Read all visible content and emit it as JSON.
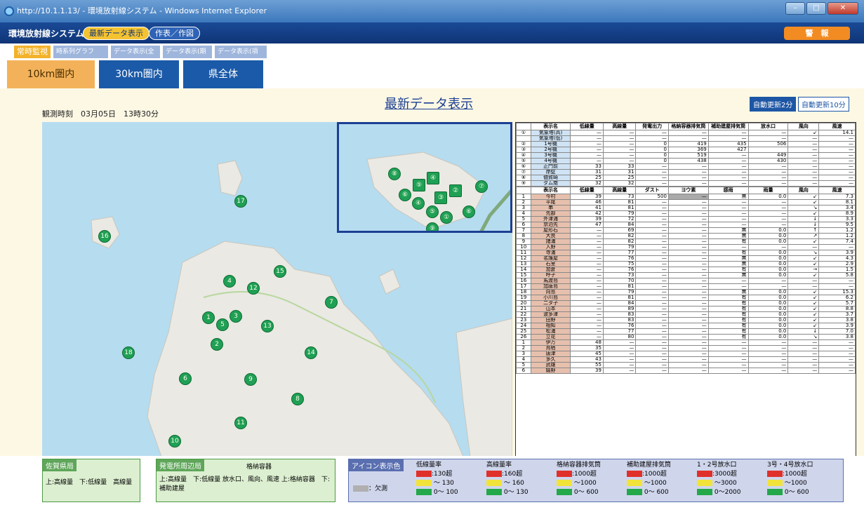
{
  "window": {
    "title": "http://10.1.1.13/ - 環境放射線システム - Windows Internet Explorer"
  },
  "app": {
    "name": "環境放射線システム",
    "btn_latest": "最新データ表示",
    "btn_chart": "作表／作図",
    "alarm": "警　報"
  },
  "subtabs": [
    "常時監視",
    "時系列グラフ",
    "データ表示(全局)",
    "データ表示(期間)",
    "データ表示(項目別)"
  ],
  "areatabs": [
    "10km圏内",
    "30km圏内",
    "県全体"
  ],
  "main": {
    "title": "最新データ表示",
    "obs_time": "観測時刻　03月05日　13時30分",
    "auto2": "自動更新2分",
    "auto10": "自動更新10分"
  },
  "map": {
    "markers": [
      "1",
      "2",
      "3",
      "4",
      "5",
      "6",
      "7",
      "8",
      "9",
      "10",
      "11",
      "12",
      "13",
      "14",
      "15",
      "16",
      "17",
      "18"
    ],
    "inset_markers": [
      "①",
      "②",
      "③",
      "④",
      "⑤",
      "⑥",
      "⑦",
      "⑧",
      "⑨",
      "⑩"
    ]
  },
  "table1": {
    "headers": [
      "",
      "表示名",
      "低線量",
      "高線量",
      "発電出力",
      "格納容器排気筒",
      "補助建屋排気筒",
      "放水口",
      "風向",
      "風速"
    ],
    "rows": [
      [
        "①",
        "気象塔(高)",
        "—",
        "—",
        "—",
        "—",
        "—",
        "—",
        "↙",
        "14.1"
      ],
      [
        "",
        "気象塔(低)",
        "—",
        "—",
        "—",
        "—",
        "—",
        "—",
        "—",
        "—"
      ],
      [
        "②",
        "1号機",
        "—",
        "—",
        "0",
        "419",
        "435",
        "506",
        "—",
        "—"
      ],
      [
        "③",
        "2号機",
        "—",
        "—",
        "0",
        "369",
        "427",
        "",
        "—",
        "—"
      ],
      [
        "④",
        "3号機",
        "—",
        "—",
        "0",
        "519",
        "—",
        "449",
        "—",
        "—"
      ],
      [
        "⑤",
        "4号機",
        "—",
        "—",
        "0",
        "438",
        "—",
        "430",
        "—",
        "—"
      ],
      [
        "⑥",
        "正門前",
        "33",
        "33",
        "—",
        "—",
        "—",
        "—",
        "—",
        "—"
      ],
      [
        "⑦",
        "岸壁",
        "31",
        "31",
        "—",
        "—",
        "—",
        "—",
        "—",
        "—"
      ],
      [
        "⑧",
        "値賀崎",
        "25",
        "25",
        "—",
        "—",
        "—",
        "—",
        "—",
        "—"
      ],
      [
        "⑨",
        "ダム南",
        "32",
        "32",
        "—",
        "—",
        "—",
        "—",
        "—",
        "—"
      ]
    ]
  },
  "table2": {
    "headers": [
      "",
      "表示名",
      "低線量",
      "高線量",
      "ダスト",
      "ヨウ素",
      "感雨",
      "雨量",
      "風向",
      "風速"
    ],
    "rows": [
      [
        "1",
        "今村",
        "39",
        "73",
        "500",
        "—",
        "無",
        "0.0",
        "↙",
        "7.3"
      ],
      [
        "2",
        "平尾",
        "46",
        "81",
        "—",
        "—",
        "—",
        "—",
        "↙",
        "8.1"
      ],
      [
        "3",
        "串",
        "41",
        "81",
        "—",
        "—",
        "—",
        "—",
        "↘",
        "3.4"
      ],
      [
        "4",
        "先部",
        "42",
        "79",
        "—",
        "—",
        "—",
        "—",
        "↙",
        "8.9"
      ],
      [
        "5",
        "外津浦",
        "39",
        "72",
        "—",
        "—",
        "—",
        "—",
        "↓",
        "3.3"
      ],
      [
        "6",
        "京泊先",
        "47",
        "84",
        "—",
        "—",
        "—",
        "—",
        "↓",
        "9.5"
      ],
      [
        "7",
        "屋形石",
        "—",
        "69",
        "—",
        "—",
        "無",
        "0.0",
        "↑",
        "1.2"
      ],
      [
        "8",
        "大良",
        "—",
        "82",
        "—",
        "—",
        "無",
        "0.0",
        "↗",
        "1.2"
      ],
      [
        "9",
        "諸浦",
        "—",
        "82",
        "—",
        "—",
        "有",
        "0.0",
        "↙",
        "7.4"
      ],
      [
        "10",
        "入野",
        "—",
        "79",
        "—",
        "—",
        "—",
        "—",
        "—",
        "—"
      ],
      [
        "11",
        "寺浦",
        "—",
        "77",
        "—",
        "—",
        "有",
        "0.0",
        "↘",
        "3.9"
      ],
      [
        "12",
        "名護屋",
        "—",
        "76",
        "—",
        "—",
        "無",
        "0.0",
        "↙",
        "4.3"
      ],
      [
        "13",
        "石室",
        "—",
        "75",
        "—",
        "—",
        "無",
        "0.0",
        "↙",
        "2.9"
      ],
      [
        "14",
        "加倉",
        "—",
        "76",
        "—",
        "—",
        "有",
        "0.0",
        "→",
        "1.5"
      ],
      [
        "15",
        "呼子",
        "—",
        "73",
        "—",
        "—",
        "無",
        "0.0",
        "↙",
        "5.8"
      ],
      [
        "16",
        "馬渡島",
        "—",
        "70",
        "—",
        "—",
        "—",
        "—",
        "—",
        "—"
      ],
      [
        "17",
        "加唐島",
        "—",
        "81",
        "—",
        "—",
        "—",
        "—",
        "—",
        "—"
      ],
      [
        "18",
        "向島",
        "—",
        "79",
        "—",
        "—",
        "無",
        "0.0",
        "↙",
        "15.3"
      ],
      [
        "19",
        "小川島",
        "—",
        "81",
        "—",
        "—",
        "有",
        "0.0",
        "↙",
        "6.2"
      ],
      [
        "20",
        "二タ子",
        "—",
        "84",
        "—",
        "—",
        "有",
        "0.0",
        "↙",
        "5.7"
      ],
      [
        "21",
        "山本",
        "—",
        "89",
        "—",
        "—",
        "有",
        "0.0",
        "↙",
        "8.8"
      ],
      [
        "22",
        "波多津",
        "—",
        "83",
        "—",
        "—",
        "有",
        "0.0",
        "↙",
        "3.7"
      ],
      [
        "23",
        "田野",
        "—",
        "83",
        "—",
        "—",
        "有",
        "0.0",
        "↙",
        "3.8"
      ],
      [
        "24",
        "相知",
        "—",
        "76",
        "—",
        "—",
        "有",
        "0.0",
        "↙",
        "3.9"
      ],
      [
        "25",
        "松浦",
        "—",
        "77",
        "—",
        "—",
        "有",
        "0.0",
        "↓",
        "7.0"
      ],
      [
        "26",
        "立花",
        "—",
        "80",
        "—",
        "—",
        "有",
        "0.0",
        "↘",
        "3.8"
      ],
      [
        "1",
        "伊万",
        "48",
        "—",
        "—",
        "—",
        "—",
        "—",
        "—",
        "—"
      ],
      [
        "2",
        "鳥栖",
        "35",
        "—",
        "—",
        "—",
        "—",
        "—",
        "—",
        "—"
      ],
      [
        "3",
        "唐津",
        "45",
        "—",
        "—",
        "—",
        "—",
        "—",
        "—",
        "—"
      ],
      [
        "4",
        "多久",
        "43",
        "—",
        "—",
        "—",
        "—",
        "—",
        "—",
        "—"
      ],
      [
        "5",
        "武雄",
        "55",
        "—",
        "—",
        "—",
        "—",
        "—",
        "—",
        "—"
      ],
      [
        "6",
        "嬉野",
        "39",
        "—",
        "—",
        "—",
        "—",
        "—",
        "—",
        "—"
      ]
    ]
  },
  "legend": {
    "l1_title": "佐賀県局",
    "l1_a": "上:高線量　下:低線量",
    "l1_b": "高線量",
    "l2_title": "発電所周辺局",
    "l2_a": "上:高線量　下:低線量",
    "l2_b": "放水口、風向、風速",
    "l2_c": "格納容器",
    "l2_d": "上:格納容器　下:補助建屋",
    "l3_title": "アイコン表示色",
    "l3_missing": "：欠測",
    "cols": [
      {
        "h": "低線量率",
        "r": ":130超",
        "y": "〜 130",
        "g": "0〜 100"
      },
      {
        "h": "高線量率",
        "r": ":160超",
        "y": "〜 160",
        "g": "0〜 130"
      },
      {
        "h": "格納容器排気筒",
        "r": ":1000超",
        "y": "〜1000",
        "g": "0〜 600"
      },
      {
        "h": "補助建屋排気筒",
        "r": ":1000超",
        "y": "〜1000",
        "g": "0〜 600"
      },
      {
        "h": "1・2号放水口",
        "r": ":3000超",
        "y": "〜3000",
        "g": "0〜2000"
      },
      {
        "h": "3号・4号放水口",
        "r": ":1000超",
        "y": "〜1000",
        "g": "0〜 600"
      }
    ],
    "colors": {
      "red": "#e0302a",
      "yellow": "#f2e33a",
      "green": "#23a84a",
      "gray": "#b0b0b0"
    }
  }
}
